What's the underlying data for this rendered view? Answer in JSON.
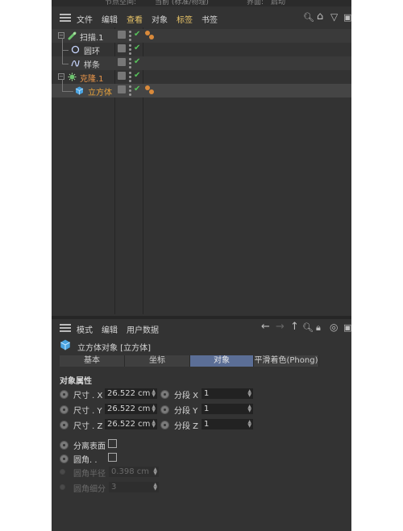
{
  "topstrip": {
    "left": "节点空间:",
    "mid": "当前 (标准/物理)",
    "right_label": "界面:",
    "right_value": "启动"
  },
  "object_manager": {
    "menu": [
      {
        "label": "文件",
        "highlight": false
      },
      {
        "label": "编辑",
        "highlight": false
      },
      {
        "label": "查看",
        "highlight": true
      },
      {
        "label": "对象",
        "highlight": false
      },
      {
        "label": "标签",
        "highlight": true
      },
      {
        "label": "书签",
        "highlight": false
      }
    ],
    "objects": [
      {
        "name": "扫描.1",
        "color": "#d6d6d6",
        "icon": "sweep-icon"
      },
      {
        "name": "圆环",
        "color": "#d6d6d6",
        "icon": "circle-spline-icon"
      },
      {
        "name": "样条",
        "color": "#d6d6d6",
        "icon": "spline-icon"
      },
      {
        "name": "克隆.1",
        "color": "#e8954a",
        "icon": "cloner-icon"
      },
      {
        "name": "立方体",
        "color": "#e8a23a",
        "icon": "cube-icon"
      }
    ]
  },
  "attribute_manager": {
    "menu": [
      "模式",
      "编辑",
      "用户数据"
    ],
    "object_title": "立方体对象 [立方体]",
    "tabs": [
      {
        "label": "基本",
        "active": false
      },
      {
        "label": "坐标",
        "active": false
      },
      {
        "label": "对象",
        "active": true
      },
      {
        "label": "平滑着色(Phong)",
        "active": false
      }
    ],
    "section_title": "对象属性",
    "size": [
      {
        "label": "尺寸 . X",
        "value": "26.522 cm",
        "seg_label": "分段 X",
        "seg_value": "1"
      },
      {
        "label": "尺寸 . Y",
        "value": "26.522 cm",
        "seg_label": "分段 Y",
        "seg_value": "1"
      },
      {
        "label": "尺寸 . Z",
        "value": "26.522 cm",
        "seg_label": "分段 Z",
        "seg_value": "1"
      }
    ],
    "separate_surfaces": "分离表面",
    "fillet": "圆角. .",
    "fillet_radius": {
      "label": "圆角半径",
      "value": "0.398 cm"
    },
    "fillet_subdiv": {
      "label": "圆角细分",
      "value": "3"
    }
  }
}
